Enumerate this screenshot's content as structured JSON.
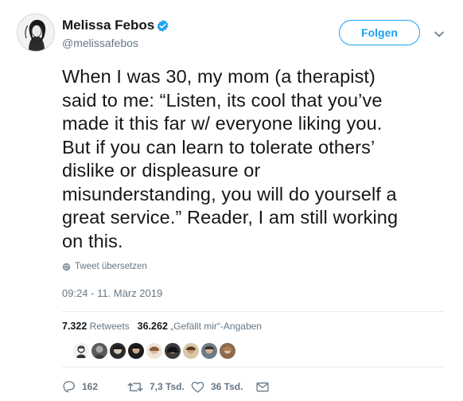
{
  "author": {
    "name": "Melissa Febos",
    "handle": "@melissafebos"
  },
  "follow_button": {
    "label": "Folgen"
  },
  "tweet": {
    "text": "When I was 30, my mom (a therapist)\nsaid to me: “Listen, its cool that you’ve\nmade it this far w/ everyone liking you.\nBut if you can learn to tolerate others’\ndislike or displeasure or\nmisunderstanding, you will do yourself a\ngreat service.” Reader, I am still working\non this.",
    "translate_label": "Tweet übersetzen",
    "timestamp": "09:24 - 11. März 2019"
  },
  "stats": {
    "retweets_count": "7.322",
    "retweets_label": "Retweets",
    "likes_count": "36.262",
    "likes_label": "„Gefällt mir“-Angaben"
  },
  "liker_avatars": [
    "avatar-1",
    "avatar-2",
    "avatar-3",
    "avatar-4",
    "avatar-5",
    "avatar-6",
    "avatar-7",
    "avatar-8",
    "avatar-9"
  ],
  "actions": {
    "reply_count": "162",
    "retweet_count": "7,3 Tsd.",
    "like_count": "36 Tsd."
  },
  "icons": {
    "verified": "verified-badge-icon",
    "caret": "chevron-down-icon",
    "globe": "globe-icon",
    "reply": "reply-icon",
    "retweet": "retweet-icon",
    "like": "heart-icon",
    "message": "envelope-icon"
  },
  "colors": {
    "accent": "#1da1f2",
    "text": "#14171a",
    "secondary": "#657786",
    "divider": "#e6ecf0"
  }
}
